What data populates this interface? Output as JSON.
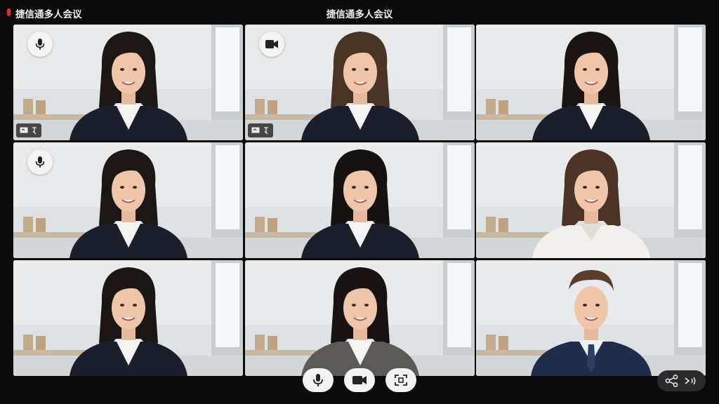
{
  "app": {
    "name": "捷信通多人会议",
    "window_title": "捷信通多人会议"
  },
  "tiles": [
    {
      "id": 1,
      "person": "woman-blazer",
      "hair": "#1c1614",
      "badge": "mic",
      "toolbar": true,
      "active": true
    },
    {
      "id": 2,
      "person": "woman-blazer",
      "hair": "#4a3426",
      "badge": "camera",
      "toolbar": true,
      "active": false
    },
    {
      "id": 3,
      "person": "woman-blazer",
      "hair": "#1a1412",
      "badge": null,
      "toolbar": false,
      "active": false
    },
    {
      "id": 4,
      "person": "woman-blazer",
      "hair": "#1c1614",
      "badge": "mic",
      "toolbar": false,
      "active": false
    },
    {
      "id": 5,
      "person": "woman-blazer",
      "hair": "#141110",
      "badge": null,
      "toolbar": false,
      "active": false
    },
    {
      "id": 6,
      "person": "woman-blouse",
      "hair": "#4d3325",
      "badge": null,
      "toolbar": false,
      "active": false
    },
    {
      "id": 7,
      "person": "woman-blazer",
      "hair": "#1b1513",
      "badge": null,
      "toolbar": false,
      "active": false
    },
    {
      "id": 8,
      "person": "woman-grey-blazer",
      "hair": "#181312",
      "badge": null,
      "toolbar": false,
      "active": false
    },
    {
      "id": 9,
      "person": "man-suit",
      "hair": "#5a3d2a",
      "badge": null,
      "toolbar": false,
      "active": false
    }
  ],
  "controls": {
    "buttons": [
      {
        "name": "mic-button",
        "icon": "microphone-icon"
      },
      {
        "name": "camera-button",
        "icon": "video-camera-icon"
      },
      {
        "name": "layout-button",
        "icon": "layout-icon"
      }
    ],
    "side": [
      {
        "name": "share-button",
        "icon": "share-icon"
      },
      {
        "name": "audio-button",
        "icon": "audio-output-icon"
      }
    ]
  },
  "colors": {
    "active_border": "#9fd66b",
    "background": "#0b0b0c",
    "recording": "#e0302a"
  }
}
